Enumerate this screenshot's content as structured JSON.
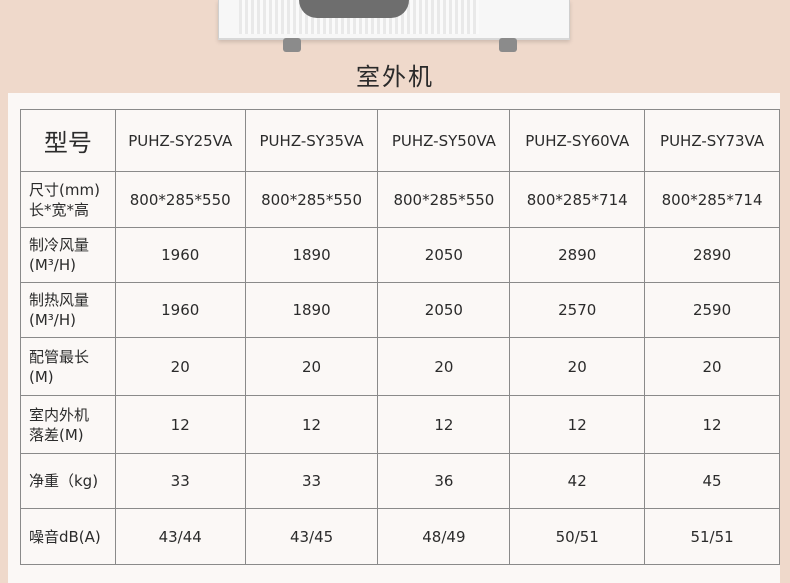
{
  "section_title": "室外机",
  "table": {
    "corner": "型号",
    "models": [
      "PUHZ-SY25VA",
      "PUHZ-SY35VA",
      "PUHZ-SY50VA",
      "PUHZ-SY60VA",
      "PUHZ-SY73VA"
    ],
    "rows": [
      {
        "label_line1": "尺寸(mm)",
        "label_line2": "长*宽*高",
        "values": [
          "800*285*550",
          "800*285*550",
          "800*285*550",
          "800*285*714",
          "800*285*714"
        ]
      },
      {
        "label_line1": "制冷风量",
        "label_line2": "(M³/H)",
        "values": [
          "1960",
          "1890",
          "2050",
          "2890",
          "2890"
        ]
      },
      {
        "label_line1": "制热风量",
        "label_line2": "(M³/H)",
        "values": [
          "1960",
          "1890",
          "2050",
          "2570",
          "2590"
        ]
      },
      {
        "label_line1": "配管最长",
        "label_line2": "(M)",
        "values": [
          "20",
          "20",
          "20",
          "20",
          "20"
        ]
      },
      {
        "label_line1": "室内外机",
        "label_line2": "落差(M)",
        "values": [
          "12",
          "12",
          "12",
          "12",
          "12"
        ]
      },
      {
        "label_line1": "净重（kg)",
        "label_line2": "",
        "values": [
          "33",
          "33",
          "36",
          "42",
          "45"
        ]
      },
      {
        "label_line1": "噪音dB(A)",
        "label_line2": "",
        "values": [
          "43/44",
          "43/45",
          "48/49",
          "50/51",
          "51/51"
        ]
      }
    ]
  }
}
